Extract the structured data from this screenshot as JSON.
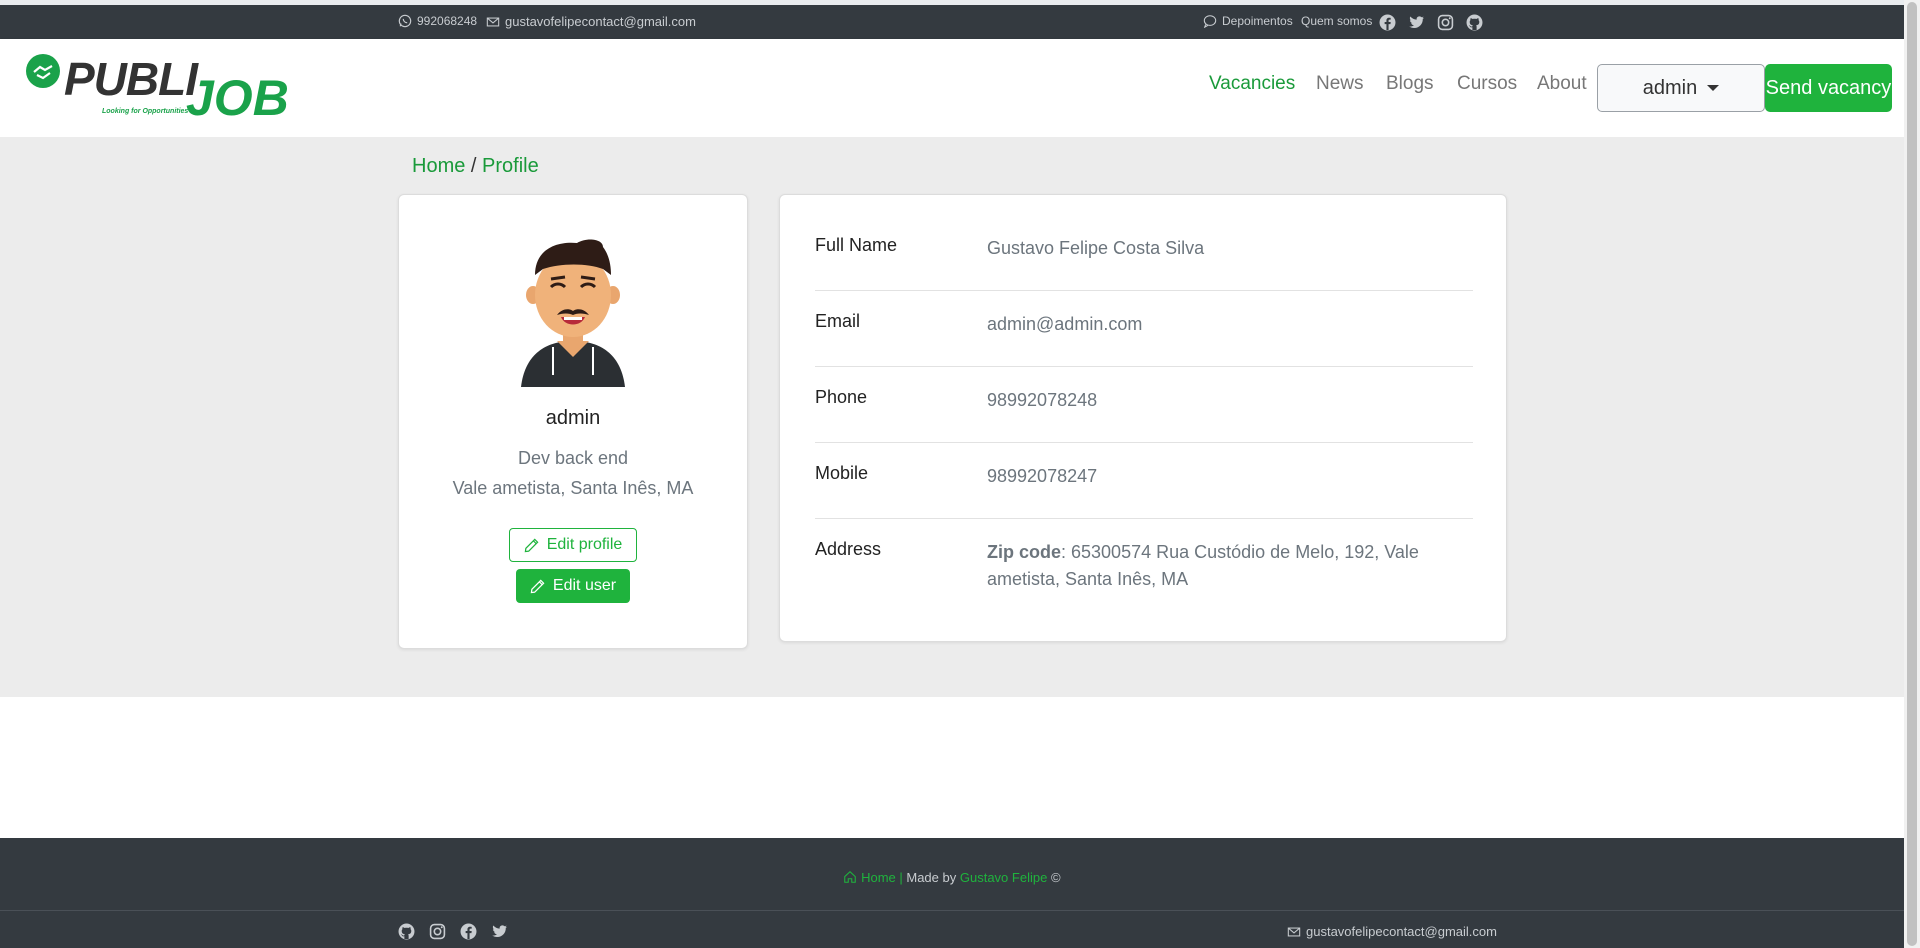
{
  "topbar": {
    "phone": "992068248",
    "email": "gustavofelipecontact@gmail.com",
    "depoimentos": "Depoimentos",
    "quem_somos": "Quem somos",
    "social": [
      "facebook-icon",
      "twitter-icon",
      "instagram-icon",
      "github-icon"
    ]
  },
  "logo": {
    "publi": "PUBLI",
    "job": "JOB",
    "tagline": "Looking for Opportunities"
  },
  "nav": {
    "vacancies": "Vacancies",
    "news": "News",
    "blogs": "Blogs",
    "cursos": "Cursos",
    "about": "About",
    "user_menu": "admin",
    "send_vacancy": "Send vacancy"
  },
  "breadcrumb": {
    "home": "Home",
    "separator": "/",
    "current": "Profile"
  },
  "profile": {
    "username": "admin",
    "role": "Dev back end",
    "location": "Vale ametista, Santa Inês, MA",
    "edit_profile": "Edit profile",
    "edit_user": "Edit user"
  },
  "details": {
    "full_name_label": "Full Name",
    "full_name": "Gustavo Felipe Costa Silva",
    "email_label": "Email",
    "email": "admin@admin.com",
    "phone_label": "Phone",
    "phone": "98992078248",
    "mobile_label": "Mobile",
    "mobile": "98992078247",
    "address_label": "Address",
    "zip_label": "Zip code",
    "address": ": 65300574 Rua Custódio de Melo, 192, Vale ametista, Santa Inês, MA"
  },
  "footer": {
    "home": "Home |",
    "made_by": "Made by",
    "author": "Gustavo Felipe",
    "copyright": "©",
    "email": "gustavofelipecontact@gmail.com"
  },
  "colors": {
    "accent": "#1fb33d",
    "dark": "#343a40",
    "background": "#ececec"
  }
}
